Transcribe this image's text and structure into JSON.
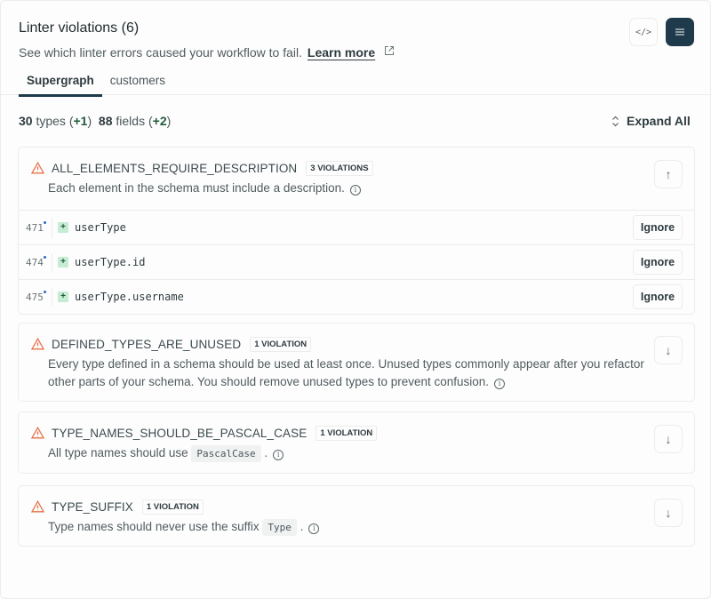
{
  "header": {
    "title": "Linter violations (6)",
    "subtitle": "See which linter errors caused your workflow to fail.",
    "learn_more": "Learn more",
    "code_button": "</>",
    "tabs": [
      {
        "label": "Supergraph",
        "active": true
      },
      {
        "label": "customers",
        "active": false
      }
    ]
  },
  "stats": {
    "types_count": "30",
    "types_label": "types",
    "types_delta": "+1",
    "fields_count": "88",
    "fields_label": "fields",
    "fields_delta": "+2"
  },
  "expand_all": "Expand All",
  "colors": {
    "accent": "#1f3a4a",
    "warning": "#e8734a",
    "added_bg": "#c6ecd4",
    "dot": "#2a6ac8"
  },
  "violations": [
    {
      "rule": "ALL_ELEMENTS_REQUIRE_DESCRIPTION",
      "badge": "3 VIOLATIONS",
      "description": "Each element in the schema must include a description.",
      "expanded": true,
      "rows": [
        {
          "line": "471",
          "marker": "+",
          "field": "userType",
          "action": "Ignore"
        },
        {
          "line": "474",
          "marker": "+",
          "field": "userType.id",
          "action": "Ignore"
        },
        {
          "line": "475",
          "marker": "+",
          "field": "userType.username",
          "action": "Ignore"
        }
      ]
    },
    {
      "rule": "DEFINED_TYPES_ARE_UNUSED",
      "badge": "1 VIOLATION",
      "description": "Every type defined in a schema should be used at least once. Unused types commonly appear after you refactor other parts of your schema. You should remove unused types to prevent confusion.",
      "expanded": false
    },
    {
      "rule": "TYPE_NAMES_SHOULD_BE_PASCAL_CASE",
      "badge": "1 VIOLATION",
      "description_prefix": "All type names should use",
      "code": "PascalCase",
      "description_suffix": ".",
      "expanded": false
    },
    {
      "rule": "TYPE_SUFFIX",
      "badge": "1 VIOLATION",
      "description_prefix": "Type names should never use the suffix",
      "code": "Type",
      "description_suffix": ".",
      "expanded": false
    }
  ]
}
